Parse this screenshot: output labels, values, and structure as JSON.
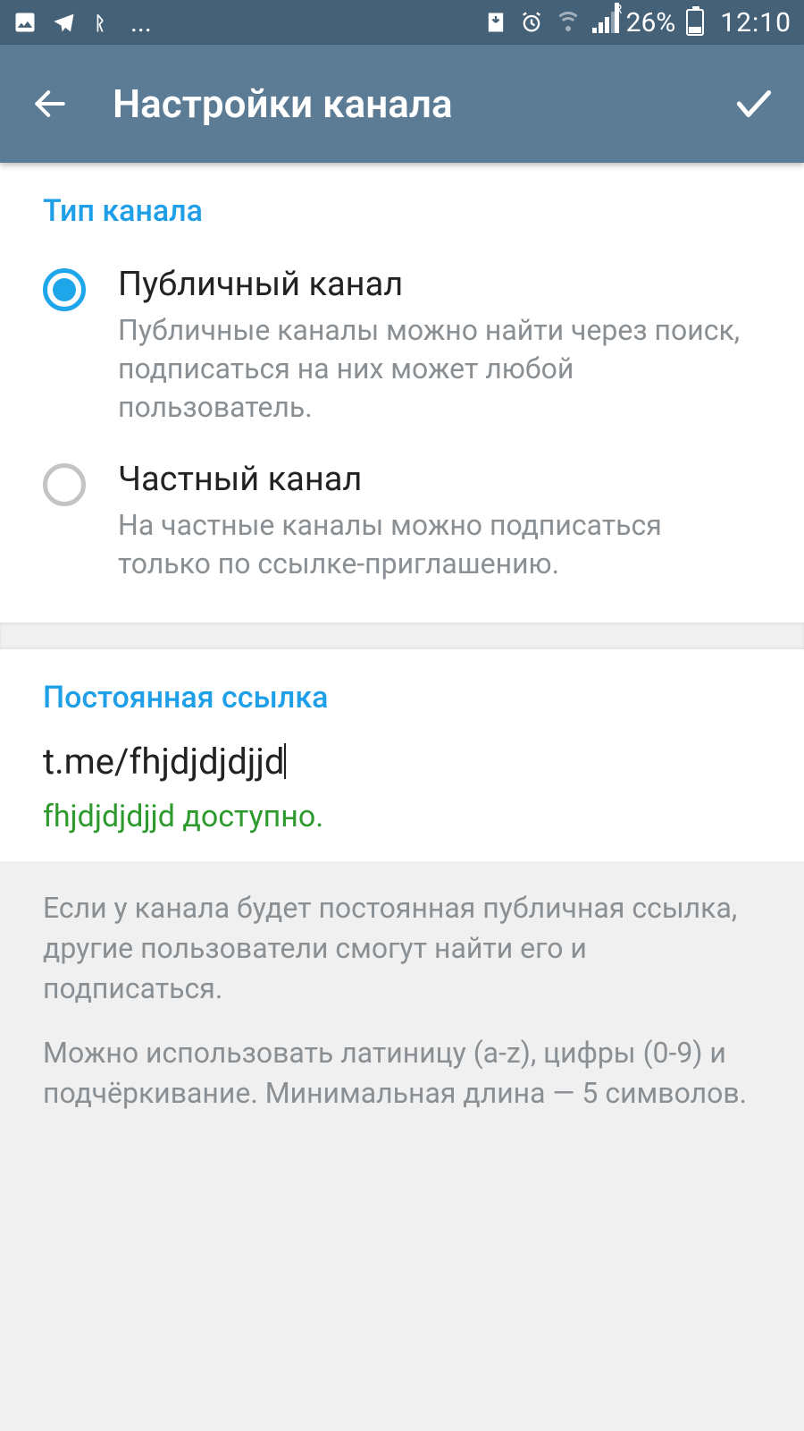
{
  "status": {
    "battery_pct": "26%",
    "time": "12:10",
    "ellipsis": "..."
  },
  "appbar": {
    "title": "Настройки канала"
  },
  "type_section": {
    "heading": "Тип канала",
    "public": {
      "label": "Публичный канал",
      "desc": "Публичные каналы можно найти через поиск, подписаться на них может любой пользователь."
    },
    "private": {
      "label": "Частный канал",
      "desc": "На частные каналы можно подписаться только по ссылке-приглашению."
    }
  },
  "link_section": {
    "heading": "Постоянная ссылка",
    "value": "t.me/fhjdjdjdjjd",
    "availability": "fhjdjdjdjjd доступно."
  },
  "info": {
    "p1": "Если у канала будет постоянная публичная ссылка, другие пользователи смогут найти его и подписаться.",
    "p2": "Можно использовать латиницу (a-z), цифры (0-9) и подчёркивание. Минимальная длина — 5 символов."
  }
}
